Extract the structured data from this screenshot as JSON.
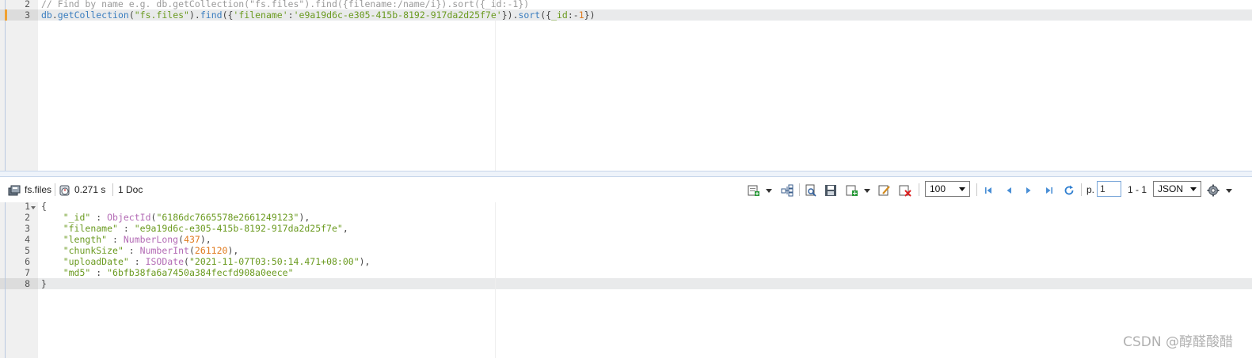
{
  "editor": {
    "lines": [
      {
        "num": "2",
        "tokens": [
          {
            "t": "// Find by name e.g. db.getCollection(\"fs.files\").find({filename:/name/i}).sort({_id:-1})",
            "c": "c-comment"
          }
        ]
      },
      {
        "num": "3",
        "tokens": [
          {
            "t": "db",
            "c": "c-ident"
          },
          {
            "t": ".",
            "c": "c-plain"
          },
          {
            "t": "getCollection",
            "c": "c-ident"
          },
          {
            "t": "(",
            "c": "c-plain"
          },
          {
            "t": "\"fs.files\"",
            "c": "c-str"
          },
          {
            "t": ").",
            "c": "c-plain"
          },
          {
            "t": "find",
            "c": "c-ident"
          },
          {
            "t": "({",
            "c": "c-plain"
          },
          {
            "t": "'filename'",
            "c": "c-str"
          },
          {
            "t": ":",
            "c": "c-plain"
          },
          {
            "t": "'e9a19d6c-e305-415b-8192-917da2d25f7e'",
            "c": "c-str"
          },
          {
            "t": "}).",
            "c": "c-plain"
          },
          {
            "t": "sort",
            "c": "c-ident"
          },
          {
            "t": "({",
            "c": "c-plain"
          },
          {
            "t": "_id",
            "c": "c-key"
          },
          {
            "t": ":-",
            "c": "c-plain"
          },
          {
            "t": "1",
            "c": "c-num"
          },
          {
            "t": "})",
            "c": "c-plain"
          }
        ]
      }
    ]
  },
  "toolbar": {
    "collection": "fs.files",
    "time": "0.271 s",
    "doc_count": "1 Doc",
    "page_size": "100",
    "page_label": "p.",
    "page_value": "1",
    "range": "1 - 1",
    "view_mode": "JSON",
    "icons": {
      "collection": "database-icon",
      "time": "stopwatch-icon",
      "add_doc": "add-document-icon",
      "tree": "tree-view-icon",
      "inspect": "inspect-icon",
      "screenshot": "save-icon",
      "insert": "insert-icon",
      "edit": "edit-document-icon",
      "delete": "delete-document-icon",
      "first": "first-page-icon",
      "prev": "previous-page-icon",
      "next": "next-page-icon",
      "last": "last-page-icon",
      "refresh": "refresh-icon",
      "settings": "gear-icon"
    }
  },
  "result": {
    "lines": [
      {
        "num": "1",
        "tokens": [
          {
            "t": "{",
            "c": "c-plain"
          }
        ]
      },
      {
        "num": "2",
        "tokens": [
          {
            "t": "    ",
            "c": "c-plain"
          },
          {
            "t": "\"_id\"",
            "c": "c-key"
          },
          {
            "t": " : ",
            "c": "c-plain"
          },
          {
            "t": "ObjectId",
            "c": "c-func"
          },
          {
            "t": "(",
            "c": "c-plain"
          },
          {
            "t": "\"6186dc7665578e2661249123\"",
            "c": "c-str"
          },
          {
            "t": "),",
            "c": "c-plain"
          }
        ]
      },
      {
        "num": "3",
        "tokens": [
          {
            "t": "    ",
            "c": "c-plain"
          },
          {
            "t": "\"filename\"",
            "c": "c-key"
          },
          {
            "t": " : ",
            "c": "c-plain"
          },
          {
            "t": "\"e9a19d6c-e305-415b-8192-917da2d25f7e\"",
            "c": "c-str"
          },
          {
            "t": ",",
            "c": "c-plain"
          }
        ]
      },
      {
        "num": "4",
        "tokens": [
          {
            "t": "    ",
            "c": "c-plain"
          },
          {
            "t": "\"length\"",
            "c": "c-key"
          },
          {
            "t": " : ",
            "c": "c-plain"
          },
          {
            "t": "NumberLong",
            "c": "c-func"
          },
          {
            "t": "(",
            "c": "c-plain"
          },
          {
            "t": "437",
            "c": "c-num"
          },
          {
            "t": "),",
            "c": "c-plain"
          }
        ]
      },
      {
        "num": "5",
        "tokens": [
          {
            "t": "    ",
            "c": "c-plain"
          },
          {
            "t": "\"chunkSize\"",
            "c": "c-key"
          },
          {
            "t": " : ",
            "c": "c-plain"
          },
          {
            "t": "NumberInt",
            "c": "c-func"
          },
          {
            "t": "(",
            "c": "c-plain"
          },
          {
            "t": "261120",
            "c": "c-num"
          },
          {
            "t": "),",
            "c": "c-plain"
          }
        ]
      },
      {
        "num": "6",
        "tokens": [
          {
            "t": "    ",
            "c": "c-plain"
          },
          {
            "t": "\"uploadDate\"",
            "c": "c-key"
          },
          {
            "t": " : ",
            "c": "c-plain"
          },
          {
            "t": "ISODate",
            "c": "c-func"
          },
          {
            "t": "(",
            "c": "c-plain"
          },
          {
            "t": "\"2021-11-07T03:50:14.471+08:00\"",
            "c": "c-str"
          },
          {
            "t": "),",
            "c": "c-plain"
          }
        ]
      },
      {
        "num": "7",
        "tokens": [
          {
            "t": "    ",
            "c": "c-plain"
          },
          {
            "t": "\"md5\"",
            "c": "c-key"
          },
          {
            "t": " : ",
            "c": "c-plain"
          },
          {
            "t": "\"6bfb38fa6a7450a384fecfd908a0eece\"",
            "c": "c-str"
          }
        ]
      },
      {
        "num": "8",
        "tokens": [
          {
            "t": "}",
            "c": "c-plain"
          }
        ]
      }
    ]
  },
  "watermark": "CSDN @醇醛酸醋",
  "colors": {
    "current_line_marker": "#f0a030",
    "string": "#6a9a1f",
    "number": "#e07b1f",
    "function": "#b36bb5",
    "identifier": "#3a7dbf"
  }
}
